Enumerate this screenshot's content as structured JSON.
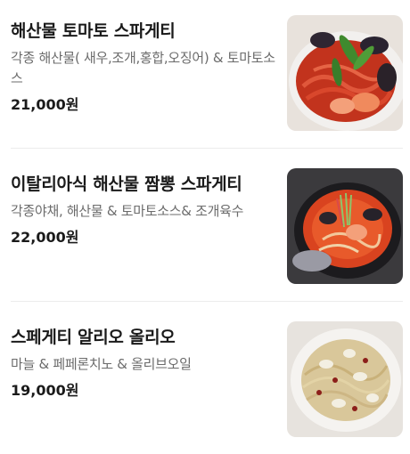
{
  "menu": {
    "items": [
      {
        "name": "해산물 토마토 스파게티",
        "description": "각종 해산물( 새우,조개,홍합,오징어) & 토마토소스",
        "price": "21,000원"
      },
      {
        "name": "이탈리아식 해산물 짬뽕 스파게티",
        "description": "각종야채, 해산물 & 토마토소스& 조개육수",
        "price": "22,000원"
      },
      {
        "name": "스페게티 알리오 올리오",
        "description": "마늘 & 페페론치노 & 올리브오일",
        "price": "19,000원"
      }
    ]
  }
}
